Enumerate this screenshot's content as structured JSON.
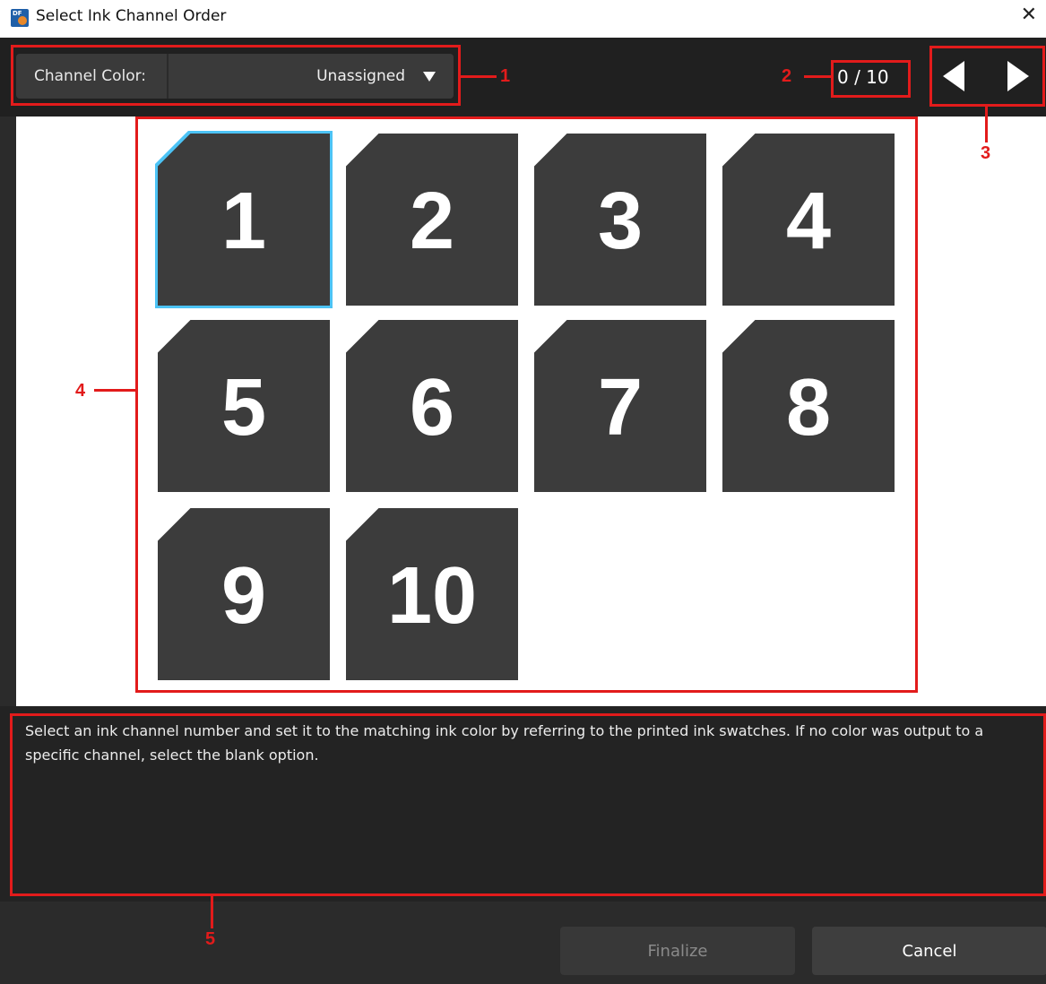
{
  "window": {
    "title": "Select Ink Channel Order",
    "close_glyph": "✕"
  },
  "toolbar": {
    "channel_color_label": "Channel Color:",
    "channel_color_value": "Unassigned",
    "counter": "0 / 10"
  },
  "tiles": [
    "1",
    "2",
    "3",
    "4",
    "5",
    "6",
    "7",
    "8",
    "9",
    "10"
  ],
  "selected_tile": "1",
  "description": "Select an ink channel number and set it to the matching ink color by referring to the printed ink swatches. If no color was output to a specific channel, select the blank option.",
  "buttons": {
    "finalize": "Finalize",
    "cancel": "Cancel"
  },
  "annotations": [
    "1",
    "2",
    "3",
    "4",
    "5"
  ],
  "colors": {
    "annotation": "#e21b1b",
    "selection": "#4cc3f5",
    "tile": "#3c3c3c",
    "dialog": "#2b2b2b"
  }
}
